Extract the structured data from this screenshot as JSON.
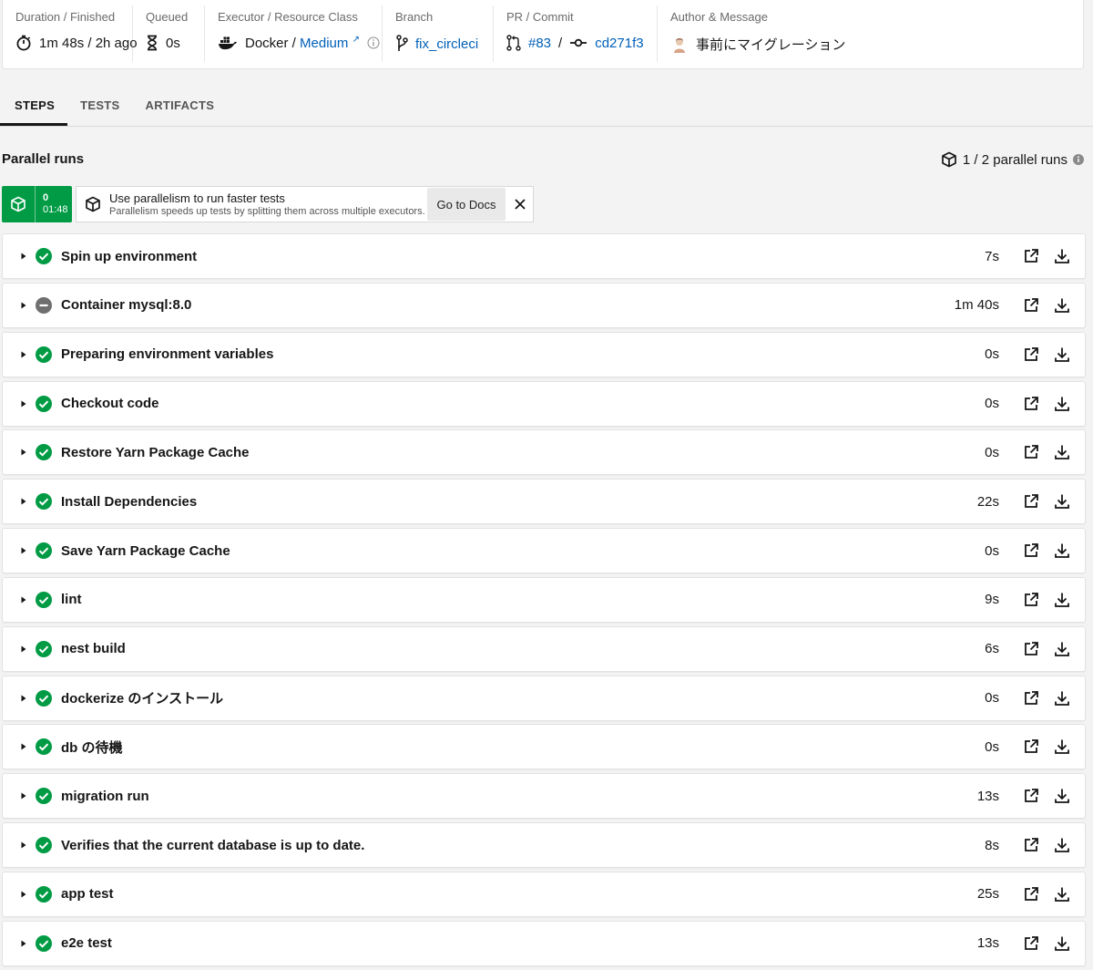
{
  "meta": {
    "duration": {
      "label": "Duration / Finished",
      "value": "1m 48s / 2h ago"
    },
    "queued": {
      "label": "Queued",
      "value": "0s"
    },
    "executor": {
      "label": "Executor / Resource Class",
      "executor": "Docker /",
      "resource_class": "Medium",
      "ext": "↗"
    },
    "branch": {
      "label": "Branch",
      "value": "fix_circleci"
    },
    "pr_commit": {
      "label": "PR / Commit",
      "pr": "#83",
      "sep": "/",
      "commit": "cd271f3"
    },
    "author": {
      "label": "Author & Message",
      "message": "事前にマイグレーション"
    }
  },
  "tabs": [
    "STEPS",
    "TESTS",
    "ARTIFACTS"
  ],
  "parallel": {
    "title": "Parallel runs",
    "count": "1 / 2 parallel runs",
    "run": {
      "index": "0",
      "time": "01:48"
    },
    "promo": {
      "title": "Use parallelism to run faster tests",
      "subtitle": "Parallelism speeds up tests by splitting them across multiple executors.",
      "button": "Go to Docs"
    }
  },
  "colors": {
    "success": "#009b44",
    "neutral": "#6f6f6f",
    "link": "#0060b8"
  },
  "steps": [
    {
      "name": "Spin up environment",
      "duration": "7s",
      "status": "success"
    },
    {
      "name": "Container mysql:8.0",
      "duration": "1m 40s",
      "status": "neutral"
    },
    {
      "name": "Preparing environment variables",
      "duration": "0s",
      "status": "success"
    },
    {
      "name": "Checkout code",
      "duration": "0s",
      "status": "success"
    },
    {
      "name": "Restore Yarn Package Cache",
      "duration": "0s",
      "status": "success"
    },
    {
      "name": "Install Dependencies",
      "duration": "22s",
      "status": "success"
    },
    {
      "name": "Save Yarn Package Cache",
      "duration": "0s",
      "status": "success"
    },
    {
      "name": "lint",
      "duration": "9s",
      "status": "success"
    },
    {
      "name": "nest build",
      "duration": "6s",
      "status": "success"
    },
    {
      "name": "dockerize のインストール",
      "duration": "0s",
      "status": "success"
    },
    {
      "name": "db の待機",
      "duration": "0s",
      "status": "success"
    },
    {
      "name": "migration run",
      "duration": "13s",
      "status": "success"
    },
    {
      "name": "Verifies that the current database is up to date.",
      "duration": "8s",
      "status": "success"
    },
    {
      "name": "app test",
      "duration": "25s",
      "status": "success"
    },
    {
      "name": "e2e test",
      "duration": "13s",
      "status": "success"
    }
  ]
}
